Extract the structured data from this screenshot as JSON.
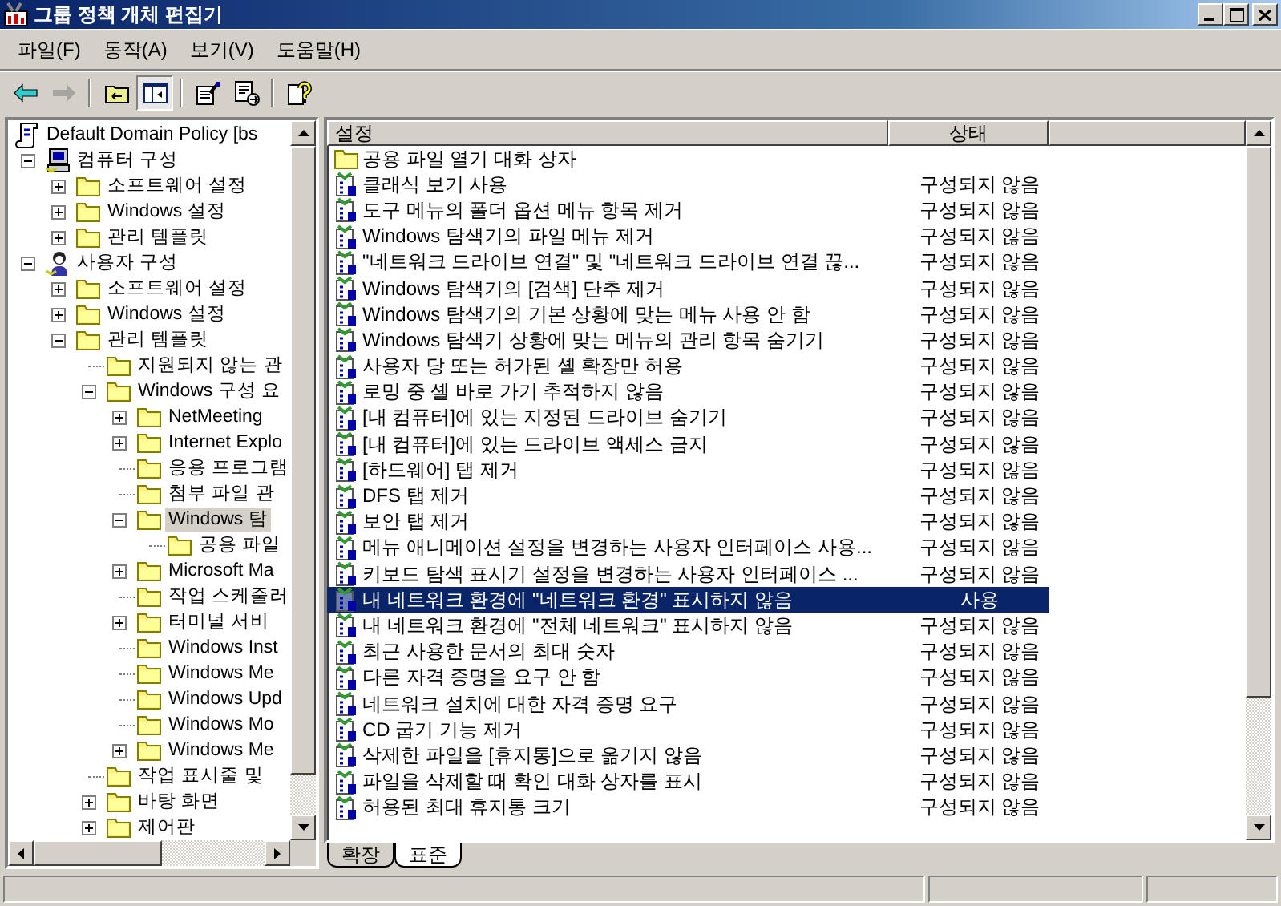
{
  "window": {
    "title": "그룹 정책 개체 편집기"
  },
  "menu": [
    "파일(F)",
    "동작(A)",
    "보기(V)",
    "도움말(H)"
  ],
  "toolbar": [
    {
      "kind": "back",
      "disabled": false
    },
    {
      "kind": "forward",
      "disabled": true
    },
    {
      "kind": "separator"
    },
    {
      "kind": "up",
      "disabled": false
    },
    {
      "kind": "tree",
      "pressed": true
    },
    {
      "kind": "separator"
    },
    {
      "kind": "properties",
      "disabled": false
    },
    {
      "kind": "export",
      "disabled": false
    },
    {
      "kind": "separator"
    },
    {
      "kind": "help",
      "disabled": false
    }
  ],
  "tree": [
    {
      "label": "Default Domain Policy [bs",
      "kind": "root",
      "selected": false,
      "children": [
        {
          "label": "컴퓨터 구성",
          "kind": "computer",
          "selected": false,
          "expanded": true,
          "children": [
            {
              "label": "소프트웨어 설정",
              "kind": "folder",
              "selected": false,
              "expanded": false
            },
            {
              "label": "Windows 설정",
              "kind": "folder",
              "selected": false,
              "expanded": false
            },
            {
              "label": "관리 템플릿",
              "kind": "folder",
              "selected": false,
              "expanded": false
            }
          ]
        },
        {
          "label": "사용자 구성",
          "kind": "user",
          "selected": false,
          "expanded": true,
          "children": [
            {
              "label": "소프트웨어 설정",
              "kind": "folder",
              "selected": false,
              "expanded": false
            },
            {
              "label": "Windows 설정",
              "kind": "folder",
              "selected": false,
              "expanded": false
            },
            {
              "label": "관리 템플릿",
              "kind": "folder",
              "selected": false,
              "expanded": true,
              "children": [
                {
                  "label": "지원되지 않는 관",
                  "kind": "folder",
                  "selected": false
                },
                {
                  "label": "Windows 구성 요",
                  "kind": "folder",
                  "selected": false,
                  "expanded": true,
                  "children": [
                    {
                      "label": "NetMeeting",
                      "kind": "folder",
                      "selected": false,
                      "expanded": false
                    },
                    {
                      "label": "Internet Explo",
                      "kind": "folder",
                      "selected": false,
                      "expanded": false
                    },
                    {
                      "label": "응용 프로그램",
                      "kind": "folder",
                      "selected": false
                    },
                    {
                      "label": "첨부 파일 관",
                      "kind": "folder",
                      "selected": false
                    },
                    {
                      "label": "Windows 탐",
                      "kind": "folder",
                      "selected": true,
                      "expanded": true,
                      "children": [
                        {
                          "label": "공용 파일",
                          "kind": "folder",
                          "selected": false
                        }
                      ]
                    },
                    {
                      "label": "Microsoft Ma",
                      "kind": "folder",
                      "selected": false,
                      "expanded": false
                    },
                    {
                      "label": "작업 스케줄러",
                      "kind": "folder",
                      "selected": false
                    },
                    {
                      "label": "터미널 서비",
                      "kind": "folder",
                      "selected": false,
                      "expanded": false
                    },
                    {
                      "label": "Windows Inst",
                      "kind": "folder",
                      "selected": false
                    },
                    {
                      "label": "Windows Me",
                      "kind": "folder",
                      "selected": false
                    },
                    {
                      "label": "Windows Upd",
                      "kind": "folder",
                      "selected": false
                    },
                    {
                      "label": "Windows Mo",
                      "kind": "folder",
                      "selected": false
                    },
                    {
                      "label": "Windows Me",
                      "kind": "folder",
                      "selected": false,
                      "expanded": false
                    }
                  ]
                },
                {
                  "label": "작업 표시줄 및",
                  "kind": "folder",
                  "selected": false
                },
                {
                  "label": "바탕 화면",
                  "kind": "folder",
                  "selected": false,
                  "expanded": false
                },
                {
                  "label": "제어판",
                  "kind": "folder",
                  "selected": false,
                  "expanded": false
                }
              ]
            }
          ]
        }
      ]
    }
  ],
  "list": {
    "columns": [
      "설정",
      "상태"
    ],
    "rows": [
      {
        "kind": "folder",
        "name": "공용 파일 열기 대화 상자",
        "selected": false
      },
      {
        "kind": "policy",
        "name": "클래식 보기 사용",
        "state": "구성되지 않음",
        "selected": false
      },
      {
        "kind": "policy",
        "name": "도구 메뉴의 폴더 옵션 메뉴 항목 제거",
        "state": "구성되지 않음",
        "selected": false
      },
      {
        "kind": "policy",
        "name": "Windows 탐색기의 파일 메뉴 제거",
        "state": "구성되지 않음",
        "selected": false
      },
      {
        "kind": "policy",
        "name": "\"네트워크 드라이브 연결\" 및 \"네트워크 드라이브 연결 끊...",
        "state": "구성되지 않음",
        "selected": false
      },
      {
        "kind": "policy",
        "name": "Windows 탐색기의 [검색] 단추 제거",
        "state": "구성되지 않음",
        "selected": false
      },
      {
        "kind": "policy",
        "name": "Windows 탐색기의 기본 상황에 맞는 메뉴 사용 안 함",
        "state": "구성되지 않음",
        "selected": false
      },
      {
        "kind": "policy",
        "name": "Windows 탐색기 상황에 맞는 메뉴의 관리 항목 숨기기",
        "state": "구성되지 않음",
        "selected": false
      },
      {
        "kind": "policy",
        "name": "사용자 당 또는 허가된 셸 확장만 허용",
        "state": "구성되지 않음",
        "selected": false
      },
      {
        "kind": "policy",
        "name": "로밍 중 셸 바로 가기 추적하지 않음",
        "state": "구성되지 않음",
        "selected": false
      },
      {
        "kind": "policy",
        "name": "[내 컴퓨터]에 있는 지정된 드라이브 숨기기",
        "state": "구성되지 않음",
        "selected": false
      },
      {
        "kind": "policy",
        "name": "[내 컴퓨터]에 있는 드라이브 액세스 금지",
        "state": "구성되지 않음",
        "selected": false
      },
      {
        "kind": "policy",
        "name": "[하드웨어] 탭 제거",
        "state": "구성되지 않음",
        "selected": false
      },
      {
        "kind": "policy",
        "name": "DFS 탭 제거",
        "state": "구성되지 않음",
        "selected": false
      },
      {
        "kind": "policy",
        "name": "보안 탭 제거",
        "state": "구성되지 않음",
        "selected": false
      },
      {
        "kind": "policy",
        "name": "메뉴 애니메이션 설정을 변경하는 사용자 인터페이스 사용...",
        "state": "구성되지 않음",
        "selected": false
      },
      {
        "kind": "policy",
        "name": "키보드 탐색 표시기 설정을 변경하는 사용자 인터페이스 ...",
        "state": "구성되지 않음",
        "selected": false
      },
      {
        "kind": "policy",
        "name": "내 네트워크 환경에 \"네트워크 환경\" 표시하지 않음",
        "state": "사용",
        "selected": true
      },
      {
        "kind": "policy",
        "name": "내 네트워크 환경에 \"전체 네트워크\" 표시하지 않음",
        "state": "구성되지 않음",
        "selected": false
      },
      {
        "kind": "policy",
        "name": "최근 사용한 문서의 최대 숫자",
        "state": "구성되지 않음",
        "selected": false
      },
      {
        "kind": "policy",
        "name": "다른 자격 증명을 요구 안 함",
        "state": "구성되지 않음",
        "selected": false
      },
      {
        "kind": "policy",
        "name": "네트워크 설치에 대한 자격 증명 요구",
        "state": "구성되지 않음",
        "selected": false
      },
      {
        "kind": "policy",
        "name": "CD 굽기 기능 제거",
        "state": "구성되지 않음",
        "selected": false
      },
      {
        "kind": "policy",
        "name": "삭제한 파일을 [휴지통]으로 옮기지 않음",
        "state": "구성되지 않음",
        "selected": false
      },
      {
        "kind": "policy",
        "name": "파일을 삭제할 때 확인 대화 상자를 표시",
        "state": "구성되지 않음",
        "selected": false
      },
      {
        "kind": "policy",
        "name": "허용된 최대 휴지통 크기",
        "state": "구성되지 않음",
        "selected": false
      }
    ]
  },
  "view_tabs": [
    {
      "label": "확장",
      "selected": false
    },
    {
      "label": "표준",
      "selected": true
    }
  ]
}
